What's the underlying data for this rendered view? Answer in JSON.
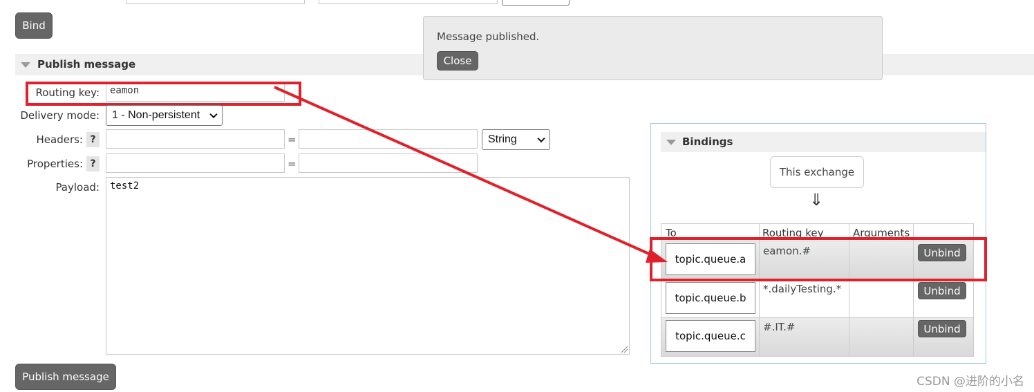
{
  "bind_button": "Bind",
  "publish_section": {
    "title": "Publish message",
    "routing_key_label": "Routing key:",
    "routing_key_value": "eamon",
    "delivery_mode_label": "Delivery mode:",
    "delivery_mode_value": "1 - Non-persistent",
    "headers_label": "Headers:",
    "headers_type": "String",
    "properties_label": "Properties:",
    "help_mark": "?",
    "equals": "=",
    "payload_label": "Payload:",
    "payload_value": "test2",
    "publish_button": "Publish message"
  },
  "notification": {
    "message": "Message published.",
    "close_label": "Close"
  },
  "bindings": {
    "title": "Bindings",
    "this_exchange": "This exchange",
    "arrow": "⇓",
    "columns": [
      "To",
      "Routing key",
      "Arguments",
      ""
    ],
    "rows": [
      {
        "to": "topic.queue.a",
        "routing_key": "eamon.#",
        "arguments": "",
        "action": "Unbind"
      },
      {
        "to": "topic.queue.b",
        "routing_key": "*.dailyTesting.*",
        "arguments": "",
        "action": "Unbind"
      },
      {
        "to": "topic.queue.c",
        "routing_key": "#.IT.#",
        "arguments": "",
        "action": "Unbind"
      }
    ]
  },
  "watermark": "CSDN @进阶的小名",
  "colors": {
    "annotation_red": "#e0202a",
    "button_gray": "#666666"
  }
}
